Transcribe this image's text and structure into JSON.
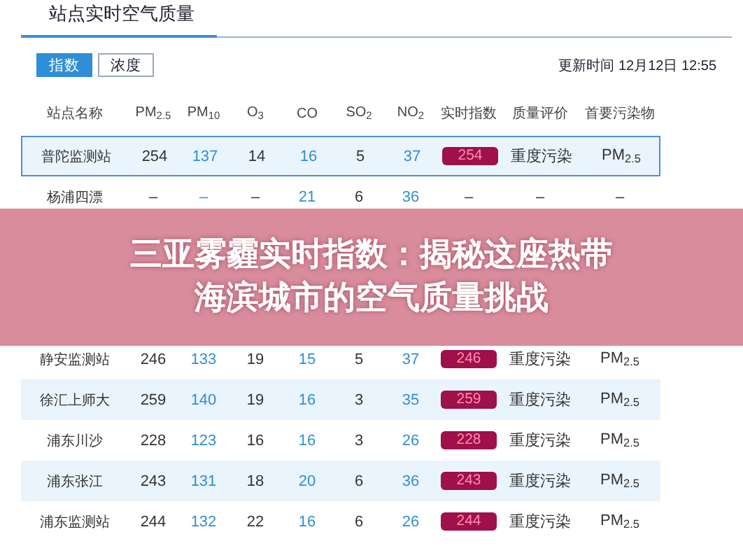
{
  "title": "站点实时空气质量",
  "tabs": [
    {
      "label": "指数",
      "selected": true
    },
    {
      "label": "浓度",
      "selected": false
    }
  ],
  "update_time": "更新时间 12月12日 12:55",
  "table": {
    "columns": [
      "站点名称",
      "PM$_{2.5}$",
      "PM$_{10}$",
      "O$_{3}$",
      "CO",
      "SO$_{2}$",
      "NO$_{2}$",
      "实时指数",
      "质量评价",
      "首要污染物"
    ],
    "rows": [
      {
        "selected": true,
        "cells": [
          "普陀监测站",
          "254",
          "137",
          "14",
          "16",
          "5",
          "37",
          "254",
          "重度污染",
          "PM$_{2.5}$"
        ]
      },
      {
        "selected": false,
        "cells": [
          "杨浦四漂",
          "–",
          "–",
          "–",
          "21",
          "6",
          "36",
          "–",
          "–",
          "–"
        ]
      },
      {
        "selected": false,
        "cells": [
          "静安监测站",
          "246",
          "133",
          "19",
          "15",
          "5",
          "37",
          "246",
          "重度污染",
          "PM$_{2.5}$"
        ]
      },
      {
        "selected": false,
        "cells": [
          "徐汇上师大",
          "259",
          "140",
          "19",
          "16",
          "3",
          "35",
          "259",
          "重度污染",
          "PM$_{2.5}$"
        ]
      },
      {
        "selected": false,
        "cells": [
          "浦东川沙",
          "228",
          "123",
          "16",
          "16",
          "3",
          "26",
          "228",
          "重度污染",
          "PM$_{2.5}$"
        ]
      },
      {
        "selected": false,
        "cells": [
          "浦东张江",
          "243",
          "131",
          "18",
          "20",
          "6",
          "36",
          "243",
          "重度污染",
          "PM$_{2.5}$"
        ]
      },
      {
        "selected": false,
        "cells": [
          "浦东监测站",
          "244",
          "132",
          "22",
          "16",
          "6",
          "26",
          "244",
          "重度污染",
          "PM$_{2.5}$"
        ]
      }
    ]
  },
  "overlay_title": "三亚雾霾实时指数：揭秘这座热带海滨城市的空气质量挑战"
}
